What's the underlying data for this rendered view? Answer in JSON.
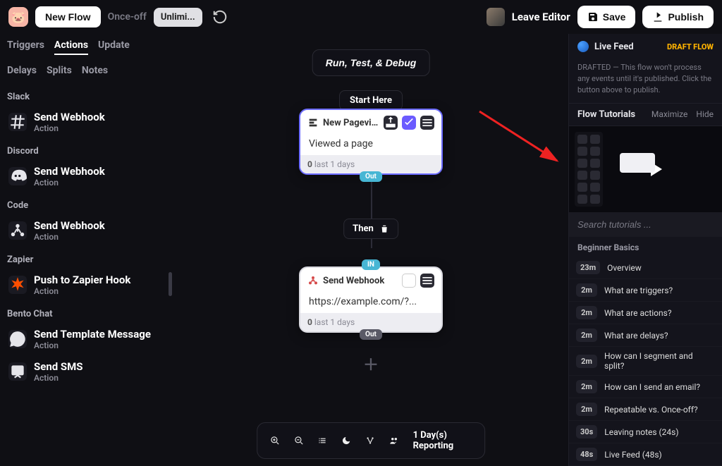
{
  "topbar": {
    "new_flow": "New Flow",
    "once_off": "Once-off",
    "unlimited": "Unlimi...",
    "leave": "Leave Editor",
    "save": "Save",
    "publish": "Publish"
  },
  "tabs": [
    "Triggers",
    "Actions",
    "Update",
    "Delays",
    "Splits",
    "Notes"
  ],
  "tabs_active": "Actions",
  "sidebar_groups": [
    {
      "label": "Slack",
      "items": [
        {
          "title": "Send Webhook",
          "sub": "Action",
          "icon": "hash"
        }
      ]
    },
    {
      "label": "Discord",
      "items": [
        {
          "title": "Send Webhook",
          "sub": "Action",
          "icon": "discord"
        }
      ]
    },
    {
      "label": "Code",
      "items": [
        {
          "title": "Send Webhook",
          "sub": "Action",
          "icon": "code"
        }
      ]
    },
    {
      "label": "Zapier",
      "items": [
        {
          "title": "Push to Zapier Hook",
          "sub": "Action",
          "icon": "zapier"
        }
      ]
    },
    {
      "label": "Bento Chat",
      "items": [
        {
          "title": "Send Template Message",
          "sub": "Action",
          "icon": "chat"
        },
        {
          "title": "Send SMS",
          "sub": "Action",
          "icon": "sms"
        }
      ]
    }
  ],
  "canvas": {
    "run_label": "Run, Test, & Debug",
    "start_here": "Start Here",
    "then": "Then",
    "node1": {
      "title": "New Pagevie...",
      "body": "Viewed a page",
      "foot_num": "0",
      "foot_text": "last 1 days",
      "out": "Out"
    },
    "node2": {
      "title": "Send Webhook",
      "body": "https://example.com/?...",
      "foot_num": "0",
      "foot_text": "last 1 days",
      "in": "IN",
      "out": "Out"
    }
  },
  "bottom": {
    "reporting": "1 Day(s) Reporting"
  },
  "rpanel": {
    "live_feed": "Live Feed",
    "draft_flow": "DRAFT FLOW",
    "draft_msg": "DRAFTED — This flow won't process any events until it's published. Click the button above to publish.",
    "flow_tutorials": "Flow Tutorials",
    "maximize": "Maximize",
    "hide": "Hide",
    "search_placeholder": "Search tutorials ...",
    "section": "Beginner Basics",
    "tutorials": [
      {
        "dur": "23m",
        "name": "Overview"
      },
      {
        "dur": "2m",
        "name": "What are triggers?"
      },
      {
        "dur": "2m",
        "name": "What are actions?"
      },
      {
        "dur": "2m",
        "name": "What are delays?"
      },
      {
        "dur": "2m",
        "name": "How can I segment and split?"
      },
      {
        "dur": "2m",
        "name": "How can I send an email?"
      },
      {
        "dur": "2m",
        "name": "Repeatable vs. Once-off?"
      },
      {
        "dur": "30s",
        "name": "Leaving notes (24s)"
      },
      {
        "dur": "48s",
        "name": "Live Feed (48s)"
      }
    ]
  }
}
